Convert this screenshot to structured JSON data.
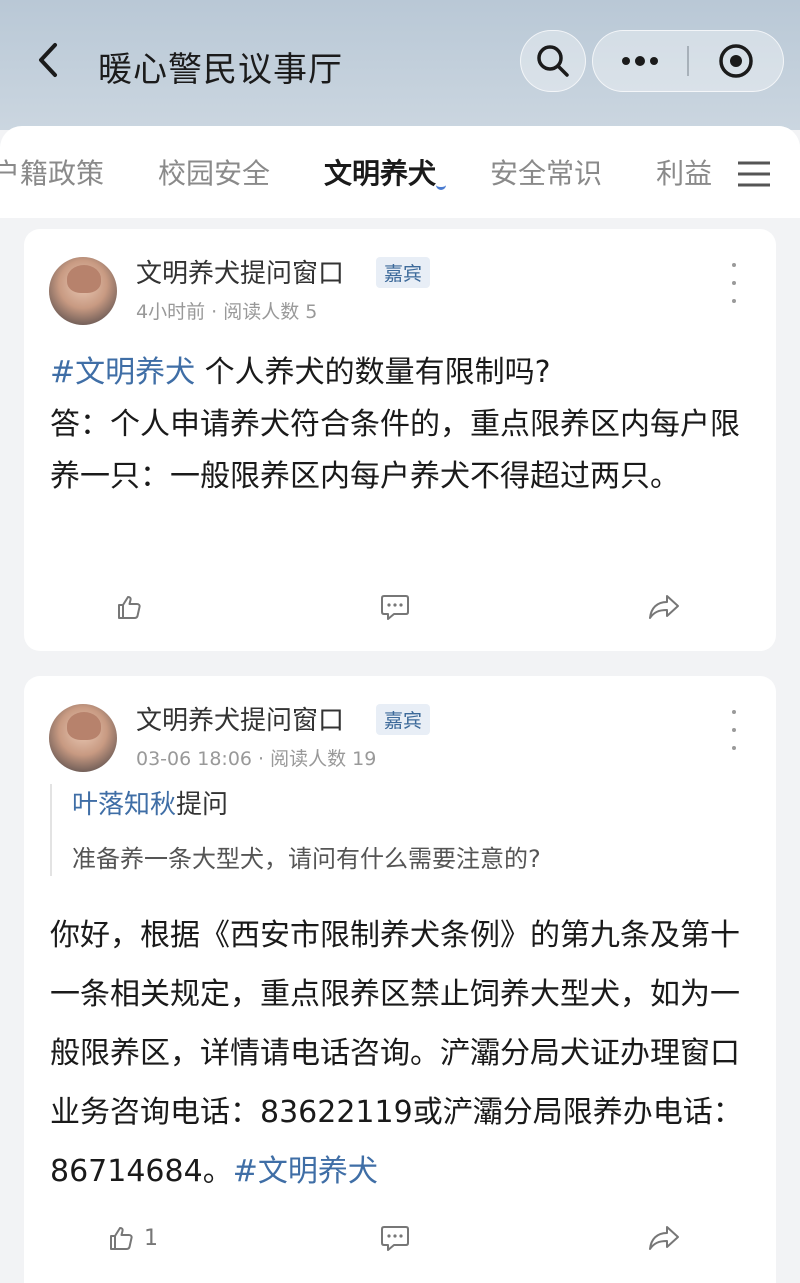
{
  "header": {
    "back_icon": "chevron-left-icon",
    "title": "暖心警民议事厅",
    "search_icon": "search-icon",
    "more_icon": "more-dots-icon",
    "close_icon": "target-circle-icon"
  },
  "tabs": {
    "items": [
      {
        "label": "户籍政策"
      },
      {
        "label": "校园安全"
      },
      {
        "label": "文明养犬",
        "active": true
      },
      {
        "label": "安全常识"
      },
      {
        "label": "利益"
      }
    ],
    "menu_icon": "hamburger-menu-icon",
    "accent": "#4a7bd0"
  },
  "posts": [
    {
      "author": "文明养犬提问窗口",
      "badge": "嘉宾",
      "meta": "4小时前 · 阅读人数 5",
      "hashtag": "#文明养犬",
      "question_text": " 个人养犬的数量有限制吗?",
      "answer_text": "答：个人申请养犬符合条件的，重点限养区内每户限养一只：一般限养区内每户养犬不得超过两只。",
      "like_count": "",
      "actions": [
        "thumbs-up-icon",
        "comment-icon",
        "share-icon"
      ]
    },
    {
      "author": "文明养犬提问窗口",
      "badge": "嘉宾",
      "meta": "03-06 18:06 · 阅读人数 19",
      "asker": "叶落知秋",
      "asker_suffix": "提问",
      "asked_question": "准备养一条大型犬，请问有什么需要注意的?",
      "answer_text": "你好，根据《西安市限制养犬条例》的第九条及第十一条相关规定，重点限养区禁止饲养大型犬，如为一般限养区，详情请电话咨询。浐灞分局犬证办理窗口业务咨询电话：83622119或浐灞分局限养办电话：86714684。",
      "hashtag": "#文明养犬",
      "like_count": "1",
      "actions": [
        "thumbs-up-icon",
        "comment-icon",
        "share-icon"
      ]
    }
  ],
  "colors": {
    "link": "#3f6ea6",
    "header_bg": "#c2cfdb",
    "page_bg": "#f2f3f5"
  }
}
